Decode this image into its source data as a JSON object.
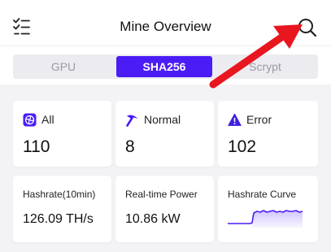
{
  "header": {
    "title": "Mine Overview",
    "menu_icon": "list-check-icon",
    "search_icon": "search-icon"
  },
  "tabs": [
    {
      "label": "GPU",
      "active": false
    },
    {
      "label": "SHA256",
      "active": true
    },
    {
      "label": "Scrypt",
      "active": false
    }
  ],
  "stats": {
    "all": {
      "label": "All",
      "value": "110",
      "icon": "all-miners-icon"
    },
    "normal": {
      "label": "Normal",
      "value": "8",
      "icon": "pickaxe-icon"
    },
    "error": {
      "label": "Error",
      "value": "102",
      "icon": "warning-icon"
    }
  },
  "metrics": {
    "hashrate": {
      "label": "Hashrate(10min)",
      "value": "126.09 TH/s"
    },
    "power": {
      "label": "Real-time Power",
      "value": "10.86 kW"
    },
    "curve": {
      "label": "Hashrate Curve",
      "icon": "sparkline-chart"
    }
  },
  "annotation": {
    "arrow_icon": "red-arrow-pointer"
  },
  "colors": {
    "accent": "#4b1cf5",
    "error": "#3f1fe0",
    "arrow": "#e8161f",
    "background": "#f3f3f6"
  }
}
